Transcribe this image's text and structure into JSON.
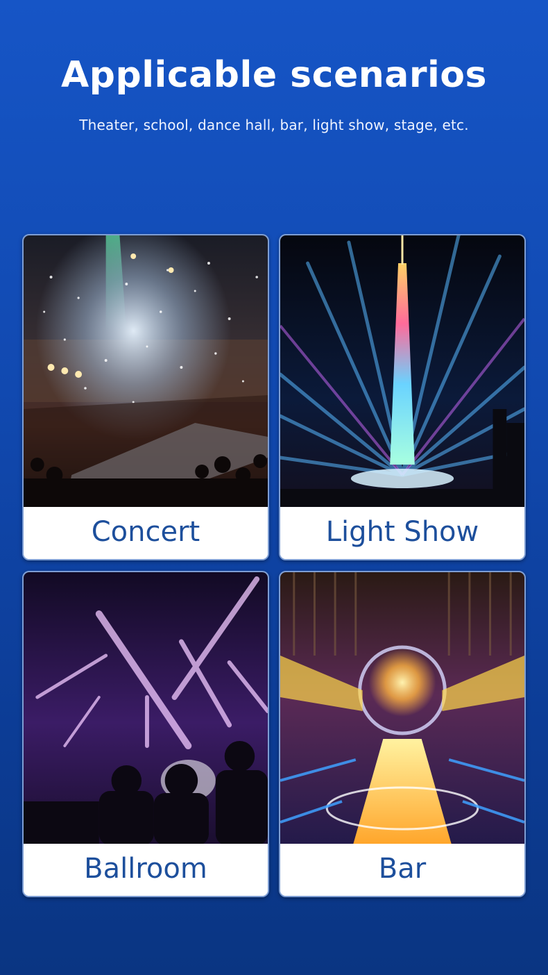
{
  "header": {
    "title": "Applicable scenarios",
    "subtitle": "Theater, school, dance hall, bar, light show, stage, etc."
  },
  "cards": [
    {
      "label": "Concert",
      "image": "concert-stage-photo"
    },
    {
      "label": "Light Show",
      "image": "tower-light-show-photo"
    },
    {
      "label": "Ballroom",
      "image": "ballroom-beam-lights-photo"
    },
    {
      "label": "Bar",
      "image": "bar-stage-photo"
    }
  ],
  "colors": {
    "background_top": "#1655c6",
    "background_bottom": "#0a3582",
    "label_text": "#1d4f9c",
    "card_border": "#7e9ed4"
  }
}
